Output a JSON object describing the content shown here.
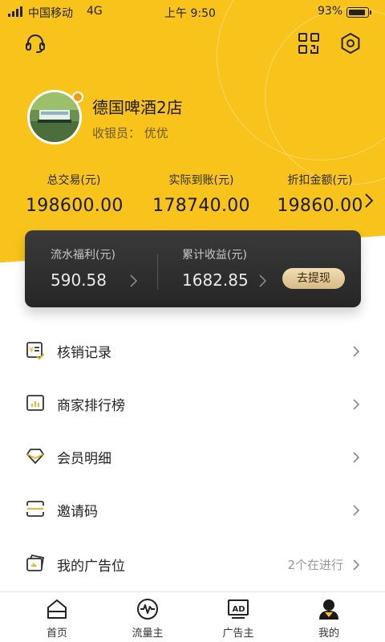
{
  "status_bar": {
    "carrier": "中国移动",
    "network": "4G",
    "time": "上午 9:50",
    "battery_pct": "93%",
    "battery_level": 0.93
  },
  "header": {
    "icons": [
      "headset-icon",
      "qr-code-icon",
      "settings-icon"
    ]
  },
  "profile": {
    "store_name": "德国啤酒2店",
    "cashier": "收银员：  优优"
  },
  "stats": [
    {
      "label": "总交易(元)",
      "value": "198600.00"
    },
    {
      "label": "实际到账(元)",
      "value": "178740.00"
    },
    {
      "label": "折扣金额(元)",
      "value": "19860.00"
    }
  ],
  "card": {
    "left_label": "流水福利(元)",
    "left_value": "590.58",
    "right_label": "累计收益(元)",
    "right_value": "1682.85",
    "withdraw_label": "去提现"
  },
  "menu": [
    {
      "label": "核销记录",
      "icon": "voucher-icon",
      "extra": ""
    },
    {
      "label": "商家排行榜",
      "icon": "ranking-chart-icon",
      "extra": ""
    },
    {
      "label": "会员明细",
      "icon": "diamond-icon",
      "extra": ""
    },
    {
      "label": "邀请码",
      "icon": "scan-code-icon",
      "extra": ""
    },
    {
      "label": "我的广告位",
      "icon": "ad-card-icon",
      "extra": "2个在进行"
    }
  ],
  "tabs": [
    {
      "label": "首页",
      "icon": "home-icon"
    },
    {
      "label": "流量主",
      "icon": "pulse-icon"
    },
    {
      "label": "广告主",
      "icon": "ad-icon"
    },
    {
      "label": "我的",
      "icon": "user-icon"
    }
  ],
  "colors": {
    "brand_yellow": "#F8C31A",
    "card_dark": "#2e2e2e",
    "withdraw_gold": "#E4C895"
  }
}
